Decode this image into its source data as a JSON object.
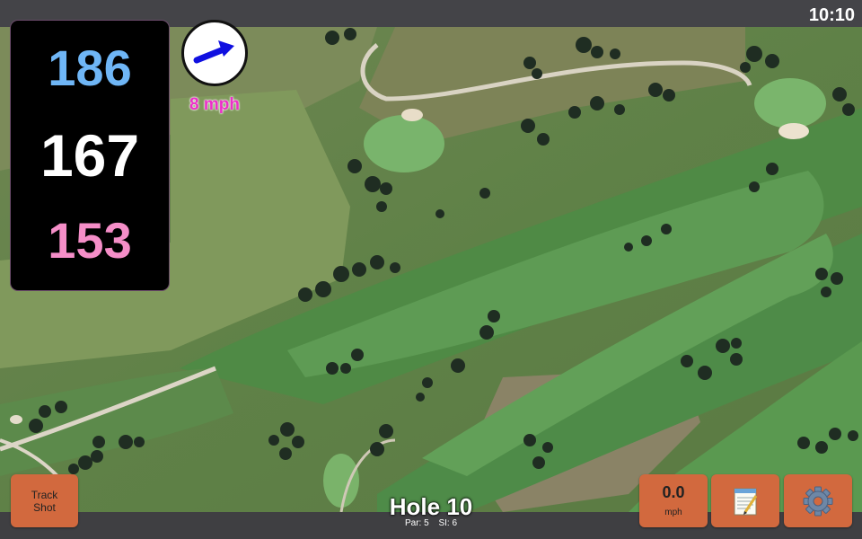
{
  "status_bar": {
    "time": "10:10"
  },
  "yardage": {
    "back": {
      "value": "186",
      "color": "#6fb6f6"
    },
    "middle": {
      "value": "167",
      "color": "#ffffff"
    },
    "front": {
      "value": "153",
      "color": "#f58ec8"
    }
  },
  "wind": {
    "speed": "8 mph",
    "icon": "wind-direction-arrow-icon",
    "arrow_color": "#1010e0"
  },
  "buttons": {
    "track_shot": {
      "line1": "Track",
      "line2": "Shot"
    },
    "speed": {
      "value": "0.0",
      "unit": "mph"
    },
    "notes": {
      "icon": "notepad-icon"
    },
    "settings": {
      "icon": "gear-icon"
    }
  },
  "hole": {
    "title": "Hole 10",
    "par": "Par: 5",
    "si": "SI: 6"
  },
  "colors": {
    "button": "#d2693e",
    "bar": "#3f3f42"
  }
}
